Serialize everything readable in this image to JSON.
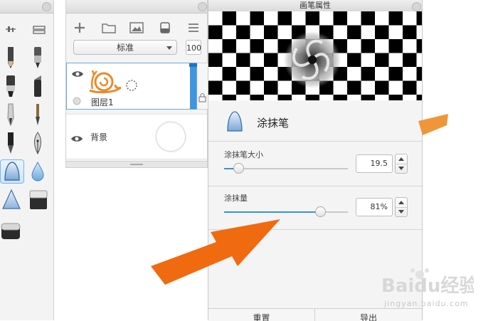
{
  "tools_palette": {
    "top_icons": [
      "sliders-icon",
      "grid-icon"
    ],
    "tools": [
      "pencil-icon",
      "marker-icon",
      "felt-pen-icon",
      "chisel-marker-icon",
      "ballpoint-pen-icon",
      "fine-brush-icon",
      "ink-pen-icon",
      "fountain-pen-icon",
      "smudge-brush-icon",
      "water-drop-icon",
      "airbrush-icon",
      "eraser-icon",
      "fill-bucket-icon"
    ],
    "selected_tool": "smudge-brush-icon"
  },
  "layers_panel": {
    "toolbar": [
      "add-layer-icon",
      "folder-icon",
      "image-icon",
      "save-icon",
      "menu-icon"
    ],
    "blend_mode": "标准",
    "opacity": "100",
    "layers": [
      {
        "name": "图层1",
        "selected": true
      },
      {
        "name": "背景",
        "selected": false
      }
    ]
  },
  "brush_properties": {
    "title": "画笔属性",
    "brush_name": "涂抹笔",
    "size": {
      "label": "涂抹笔大小",
      "value": "19.5",
      "fraction": 0.12
    },
    "amount": {
      "label": "涂抹量",
      "value": "81%",
      "fraction": 0.78
    },
    "reset_label": "重置",
    "export_label": "导出"
  },
  "annotations": {
    "arrow_color": "#f06a10"
  },
  "watermark": {
    "brand": "Baidu经验",
    "sub": "jingyan.baidu.com"
  },
  "colors": {
    "accent": "#3b8fd9",
    "snail": "#e98a2a"
  }
}
